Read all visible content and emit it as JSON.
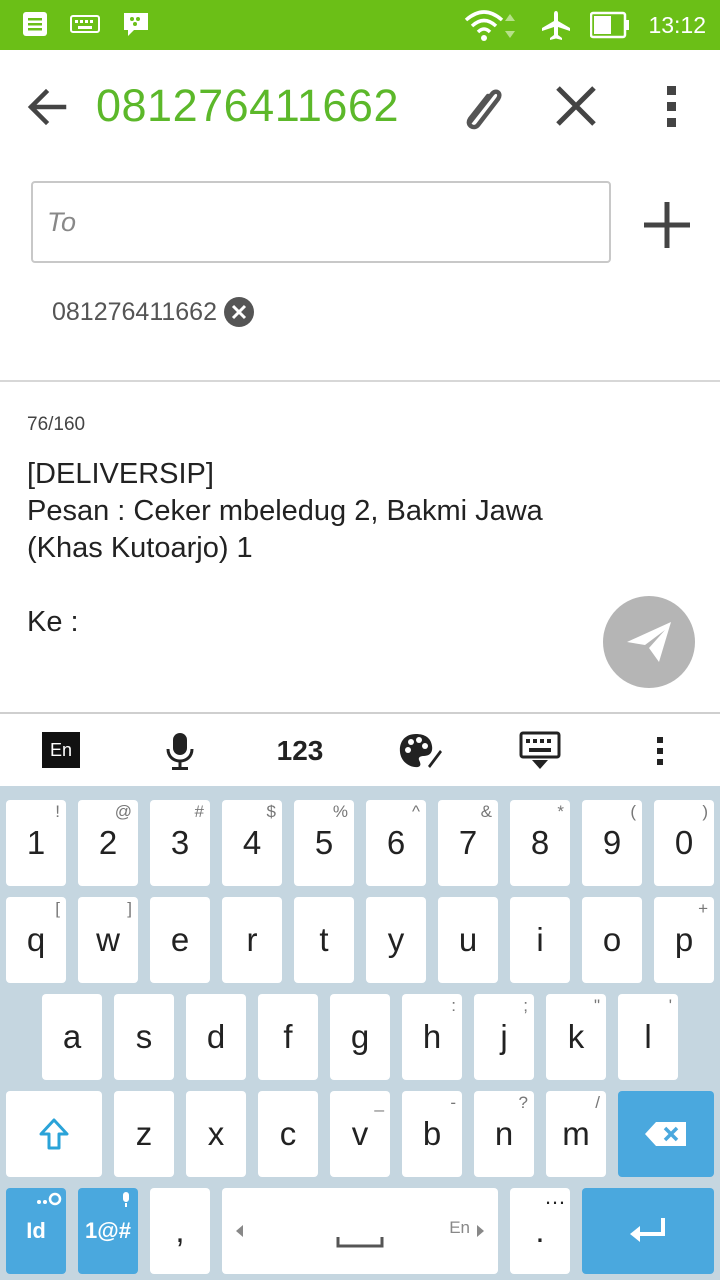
{
  "status_bar": {
    "time": "13:12"
  },
  "header": {
    "title": "081276411662"
  },
  "recipient": {
    "placeholder": "To",
    "chip": "081276411662"
  },
  "message": {
    "counter": "76/160",
    "body": "[DELIVERSIP]\nPesan : Ceker mbeledug 2, Bakmi Jawa\n(Khas Kutoarjo) 1\n\nKe :"
  },
  "keyboard": {
    "toolbar": {
      "lang": "En",
      "numbers": "123"
    },
    "row1": [
      {
        "label": "1",
        "sub": "!"
      },
      {
        "label": "2",
        "sub": "@"
      },
      {
        "label": "3",
        "sub": "#"
      },
      {
        "label": "4",
        "sub": "$"
      },
      {
        "label": "5",
        "sub": "%"
      },
      {
        "label": "6",
        "sub": "^"
      },
      {
        "label": "7",
        "sub": "&"
      },
      {
        "label": "8",
        "sub": "*"
      },
      {
        "label": "9",
        "sub": "("
      },
      {
        "label": "0",
        "sub": ")"
      }
    ],
    "row2": [
      {
        "label": "q",
        "sub": "["
      },
      {
        "label": "w",
        "sub": "]"
      },
      {
        "label": "e",
        "sub": ""
      },
      {
        "label": "r",
        "sub": ""
      },
      {
        "label": "t",
        "sub": ""
      },
      {
        "label": "y",
        "sub": ""
      },
      {
        "label": "u",
        "sub": ""
      },
      {
        "label": "i",
        "sub": ""
      },
      {
        "label": "o",
        "sub": ""
      },
      {
        "label": "p",
        "sub": "+"
      }
    ],
    "row3": [
      {
        "label": "a",
        "sub": ""
      },
      {
        "label": "s",
        "sub": ""
      },
      {
        "label": "d",
        "sub": ""
      },
      {
        "label": "f",
        "sub": ""
      },
      {
        "label": "g",
        "sub": ""
      },
      {
        "label": "h",
        "sub": ":"
      },
      {
        "label": "j",
        "sub": ";"
      },
      {
        "label": "k",
        "sub": "\""
      },
      {
        "label": "l",
        "sub": "'"
      }
    ],
    "row4": [
      {
        "label": "z",
        "sub": ""
      },
      {
        "label": "x",
        "sub": ""
      },
      {
        "label": "c",
        "sub": ""
      },
      {
        "label": "v",
        "sub": "_"
      },
      {
        "label": "b",
        "sub": "-"
      },
      {
        "label": "n",
        "sub": "?"
      },
      {
        "label": "m",
        "sub": "/"
      }
    ],
    "bottom": {
      "lang_key": "Id",
      "symbols_key": "1@#",
      "comma": ",",
      "space_lang": "En",
      "period": ".",
      "period_sub": "…"
    }
  }
}
